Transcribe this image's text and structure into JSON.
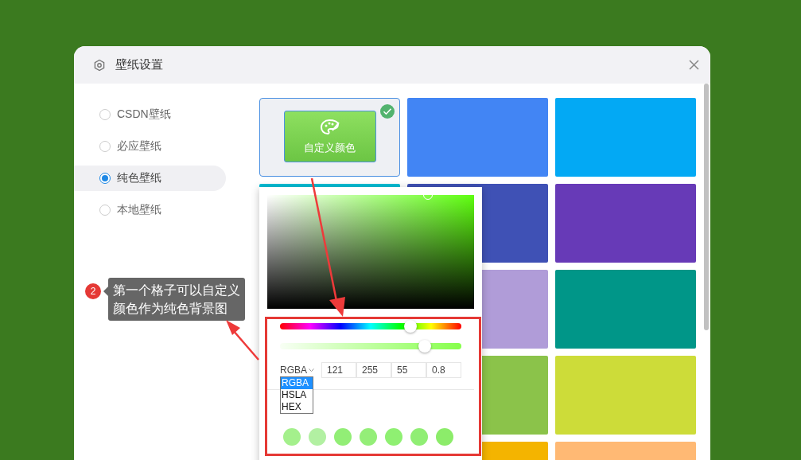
{
  "dialog": {
    "title": "壁纸设置"
  },
  "sources": [
    {
      "label": "CSDN壁纸",
      "selected": false
    },
    {
      "label": "必应壁纸",
      "selected": false
    },
    {
      "label": "纯色壁纸",
      "selected": true
    },
    {
      "label": "本地壁纸",
      "selected": false
    }
  ],
  "tiles": [
    {
      "kind": "custom",
      "label": "自定义颜色",
      "selected": true
    },
    {
      "kind": "color",
      "color": "#4285f4",
      "selected": false
    },
    {
      "kind": "color",
      "color": "#03a9f4",
      "selected": false
    },
    {
      "kind": "color",
      "color": "#00bcd4",
      "selected": false
    },
    {
      "kind": "color",
      "color": "#3f51b5",
      "selected": false
    },
    {
      "kind": "color",
      "color": "#673ab7",
      "selected": false
    },
    {
      "kind": "color",
      "color": "#b09cd8",
      "selected": false
    },
    {
      "kind": "color",
      "color": "#009688",
      "selected": false
    },
    {
      "kind": "color",
      "color": "#8bc34a",
      "selected": false
    },
    {
      "kind": "color",
      "color": "#cddc39",
      "selected": false
    },
    {
      "kind": "color",
      "color": "#f4b400",
      "selected": false
    },
    {
      "kind": "color",
      "color": "#ffb974",
      "selected": false
    }
  ],
  "color_picker": {
    "hue": {
      "level": 0.72
    },
    "alpha": {
      "level": 0.8
    },
    "format": "RGBA",
    "values": [
      "121",
      "255",
      "55",
      "0.8"
    ],
    "format_options": [
      {
        "label": "RGBA",
        "selected": true
      },
      {
        "label": "HSLA",
        "selected": false
      },
      {
        "label": "HEX",
        "selected": false
      }
    ],
    "presets": [
      {
        "color": "#a4f08c"
      },
      {
        "color": "#b2f0a2"
      },
      {
        "color": "#92ee76"
      },
      {
        "color": "#94ee78"
      },
      {
        "color": "#8ff072"
      },
      {
        "color": "#90ee74"
      },
      {
        "color": "#8cec6a"
      }
    ]
  },
  "annotation": {
    "badge": "2",
    "text": "第一个格子可以自定义颜色作为纯色背景图"
  }
}
